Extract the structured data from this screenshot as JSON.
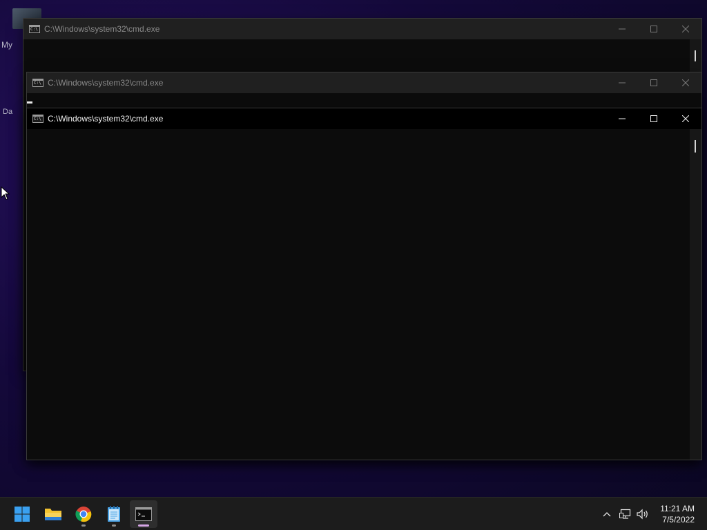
{
  "desktop": {
    "labels": [
      "My",
      "Da"
    ]
  },
  "windows": [
    {
      "title": "C:\\Windows\\system32\\cmd.exe",
      "state": "inactive",
      "icon_text": "C:\\"
    },
    {
      "title": "C:\\Windows\\system32\\cmd.exe",
      "state": "inactive",
      "icon_text": "C:\\"
    },
    {
      "title": "C:\\Windows\\system32\\cmd.exe",
      "state": "active",
      "icon_text": "C:\\"
    }
  ],
  "taskbar": {
    "apps": [
      {
        "name": "start-menu",
        "icon": "windows-logo-icon"
      },
      {
        "name": "file-explorer",
        "icon": "folder-icon"
      },
      {
        "name": "chrome",
        "icon": "chrome-icon",
        "running": true
      },
      {
        "name": "notepad",
        "icon": "notepad-icon",
        "running": true
      },
      {
        "name": "command-prompt",
        "icon": "terminal-icon",
        "running": true,
        "focused": true
      }
    ],
    "tray": {
      "overflow_icon": "chevron-up-icon",
      "network_icon": "network-icon",
      "volume_icon": "volume-icon"
    },
    "clock": {
      "time": "11:21 AM",
      "date": "7/5/2022"
    }
  },
  "colors": {
    "accent_focus_indicator": "#d6a6e6",
    "terminal_bg": "#0c0c0c",
    "active_titlebar": "#000000",
    "inactive_titlebar": "#202020"
  }
}
